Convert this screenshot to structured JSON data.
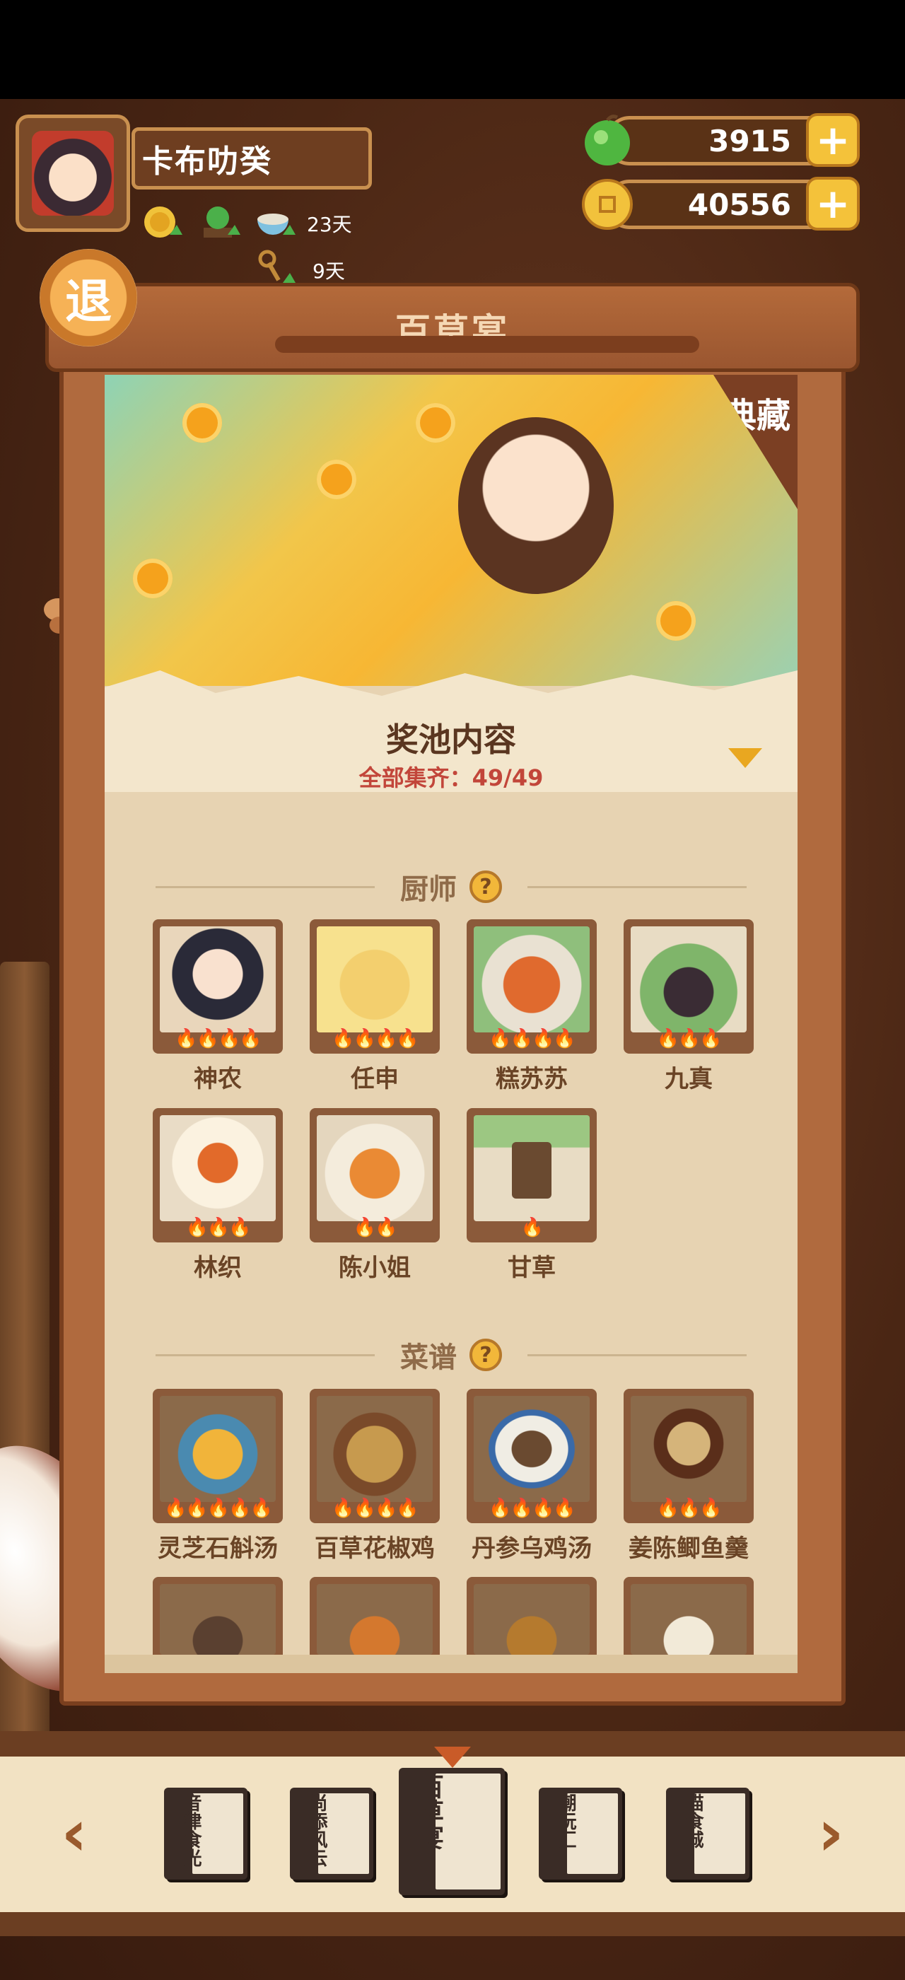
{
  "player": {
    "name": "卡布叻癸"
  },
  "stats": {
    "item3_value": "23天",
    "item4_value": "9天"
  },
  "currency": {
    "gems": "3915",
    "coins": "40556",
    "plus": "+"
  },
  "header": {
    "back_label": "退",
    "title": "百草宴"
  },
  "banner": {
    "tag": "典藏"
  },
  "pool": {
    "title": "奖池内容",
    "subtitle": "全部集齐：49/49"
  },
  "sections": {
    "chefs": {
      "title": "厨师",
      "items": [
        {
          "name": "神农",
          "stars": "🔥🔥🔥🔥"
        },
        {
          "name": "任申",
          "stars": "🔥🔥🔥🔥"
        },
        {
          "name": "糕苏苏",
          "stars": "🔥🔥🔥🔥"
        },
        {
          "name": "九真",
          "stars": "🔥🔥🔥"
        },
        {
          "name": "林织",
          "stars": "🔥🔥🔥"
        },
        {
          "name": "陈小姐",
          "stars": "🔥🔥"
        },
        {
          "name": "甘草",
          "stars": "🔥"
        }
      ]
    },
    "recipes": {
      "title": "菜谱",
      "items": [
        {
          "name": "灵芝石斛汤",
          "stars": "🔥🔥🔥🔥🔥"
        },
        {
          "name": "百草花椒鸡",
          "stars": "🔥🔥🔥🔥"
        },
        {
          "name": "丹参乌鸡汤",
          "stars": "🔥🔥🔥🔥"
        },
        {
          "name": "姜陈鲫鱼羹",
          "stars": "🔥🔥🔥"
        }
      ]
    },
    "help": "?"
  },
  "nav": {
    "prev": "‹",
    "next": "›",
    "books": [
      "音律食光",
      "尚添风云",
      "百草宴",
      "潮玩汇",
      "喵食城"
    ]
  },
  "colors": {
    "accent": "#f4c23a",
    "frame": "#c9904f",
    "title_text": "#f5d8b5",
    "highlight_red": "#c2463a"
  }
}
